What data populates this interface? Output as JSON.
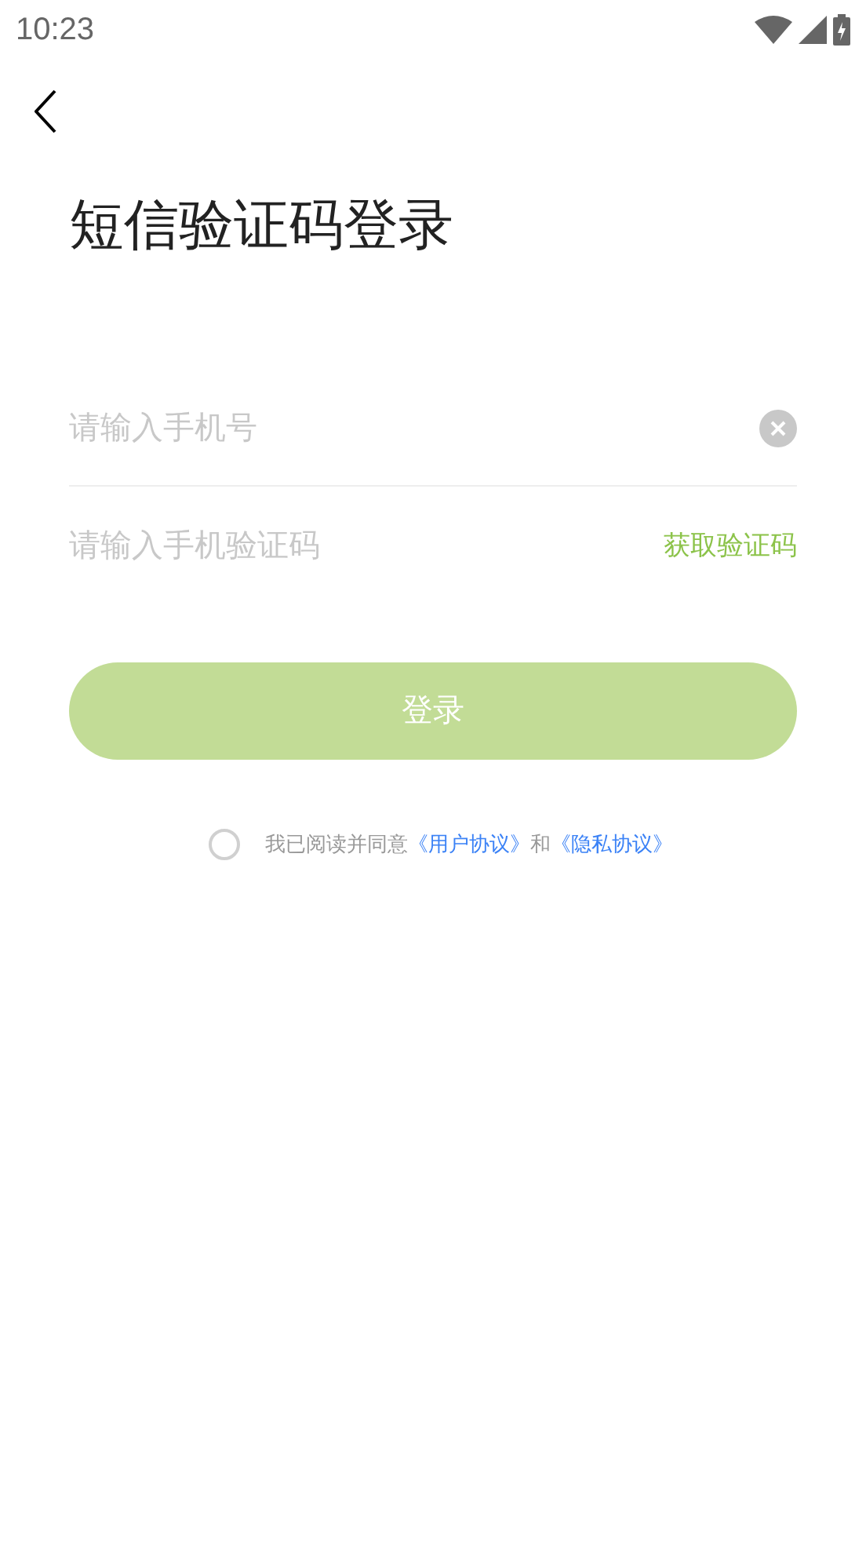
{
  "status_bar": {
    "time": "10:23"
  },
  "title": "短信验证码登录",
  "phone_field": {
    "placeholder": "请输入手机号"
  },
  "code_field": {
    "placeholder": "请输入手机验证码",
    "action": "获取验证码"
  },
  "login_button": {
    "label": "登录",
    "disabled": true
  },
  "agreement": {
    "checked": false,
    "prefix": "我已阅读并同意",
    "link_1": "《用户协议》",
    "conjunction": "和",
    "link_2": "《隐私协议》"
  }
}
